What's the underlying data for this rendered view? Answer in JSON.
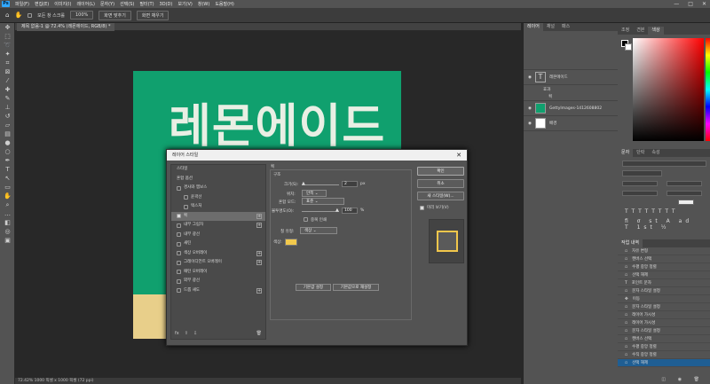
{
  "menu": {
    "logo": "Ps",
    "items": [
      "파일(F)",
      "편집(E)",
      "이미지(I)",
      "레이어(L)",
      "문자(Y)",
      "선택(S)",
      "필터(T)",
      "3D(D)",
      "보기(V)",
      "창(W)",
      "도움말(H)"
    ]
  },
  "window_controls": [
    "—",
    "□",
    "✕"
  ],
  "options": {
    "checkbox": "모든 창 스크롤",
    "zoom": "100%",
    "btn_fit_screen": "화면 맞추기",
    "btn_fill_screen": "화면 채우기"
  },
  "doc_tab": "제목 없음-1 @ 72.4% (레몬에이드, RGB/8) *",
  "canvas_text": "레몬에이드",
  "status": "72.42%   1000 픽셀 x 1000 픽셀 (72 ppi)",
  "layers_panel": {
    "tabs": [
      "레이어",
      "채널",
      "패스"
    ],
    "layers": [
      {
        "name": "레몬에이드",
        "fx": "fx"
      },
      {
        "name": "효과"
      },
      {
        "name": "획"
      },
      {
        "name": "GettyImages-1412608802"
      },
      {
        "name": "배경"
      }
    ]
  },
  "color_panel": {
    "tabs": [
      "조정",
      "견본",
      "색상"
    ]
  },
  "char_panel": {
    "tabs": [
      "문자",
      "단락",
      "속성"
    ]
  },
  "history_panel": {
    "title": "작업 내역",
    "items": [
      "자유 변형",
      "캔버스 선택",
      "수평 중앙 정렬",
      "선택 해제",
      "포인트 문자",
      "문자 스타일 설정",
      "이동",
      "문자 스타일 설정",
      "레이어 가시성",
      "레이어 가시성",
      "문자 스타일 설정",
      "캔버스 선택",
      "수평 중앙 정렬",
      "수직 중앙 정렬",
      "선택 해제"
    ]
  },
  "dialog": {
    "title": "레이어 스타일",
    "styles": [
      {
        "label": "스타일",
        "cb": false,
        "plus": false,
        "sel": false,
        "nocb": true
      },
      {
        "label": "혼합 옵션",
        "cb": false,
        "plus": false,
        "sel": false,
        "nocb": true
      },
      {
        "label": "경사와 엠보스",
        "cb": false,
        "plus": false,
        "sel": false
      },
      {
        "label": "윤곽선",
        "cb": false,
        "plus": false,
        "sel": false,
        "indent": true
      },
      {
        "label": "텍스처",
        "cb": false,
        "plus": false,
        "sel": false,
        "indent": true
      },
      {
        "label": "획",
        "cb": true,
        "plus": true,
        "sel": true
      },
      {
        "label": "내부 그림자",
        "cb": false,
        "plus": true,
        "sel": false
      },
      {
        "label": "내부 광선",
        "cb": false,
        "plus": false,
        "sel": false
      },
      {
        "label": "새틴",
        "cb": false,
        "plus": false,
        "sel": false
      },
      {
        "label": "색상 오버레이",
        "cb": false,
        "plus": true,
        "sel": false
      },
      {
        "label": "그레이디언트 오버레이",
        "cb": false,
        "plus": true,
        "sel": false
      },
      {
        "label": "패턴 오버레이",
        "cb": false,
        "plus": false,
        "sel": false
      },
      {
        "label": "외부 광선",
        "cb": false,
        "plus": false,
        "sel": false
      },
      {
        "label": "드롭 섀도",
        "cb": false,
        "plus": true,
        "sel": false
      }
    ],
    "section": "획",
    "structure": "구조",
    "size_label": "크기(S):",
    "size_value": "2",
    "size_unit": "px",
    "position_label": "위치:",
    "position_value": "안쪽",
    "blend_label": "혼합 모드:",
    "blend_value": "표준",
    "opacity_label": "불투명도(O):",
    "opacity_value": "100",
    "opacity_unit": "%",
    "overprint": "중복 인쇄",
    "filltype_label": "칠 유형:",
    "filltype_value": "색상",
    "color_label": "색상:",
    "make_default": "기본값 설정",
    "reset_default": "기본값으로 재설정",
    "ok": "확인",
    "cancel": "취소",
    "new_style": "새 스타일(W)...",
    "preview": "미리 보기(V)",
    "bottom_icons": [
      "fx",
      "⇧",
      "⇩",
      "🗑"
    ]
  }
}
